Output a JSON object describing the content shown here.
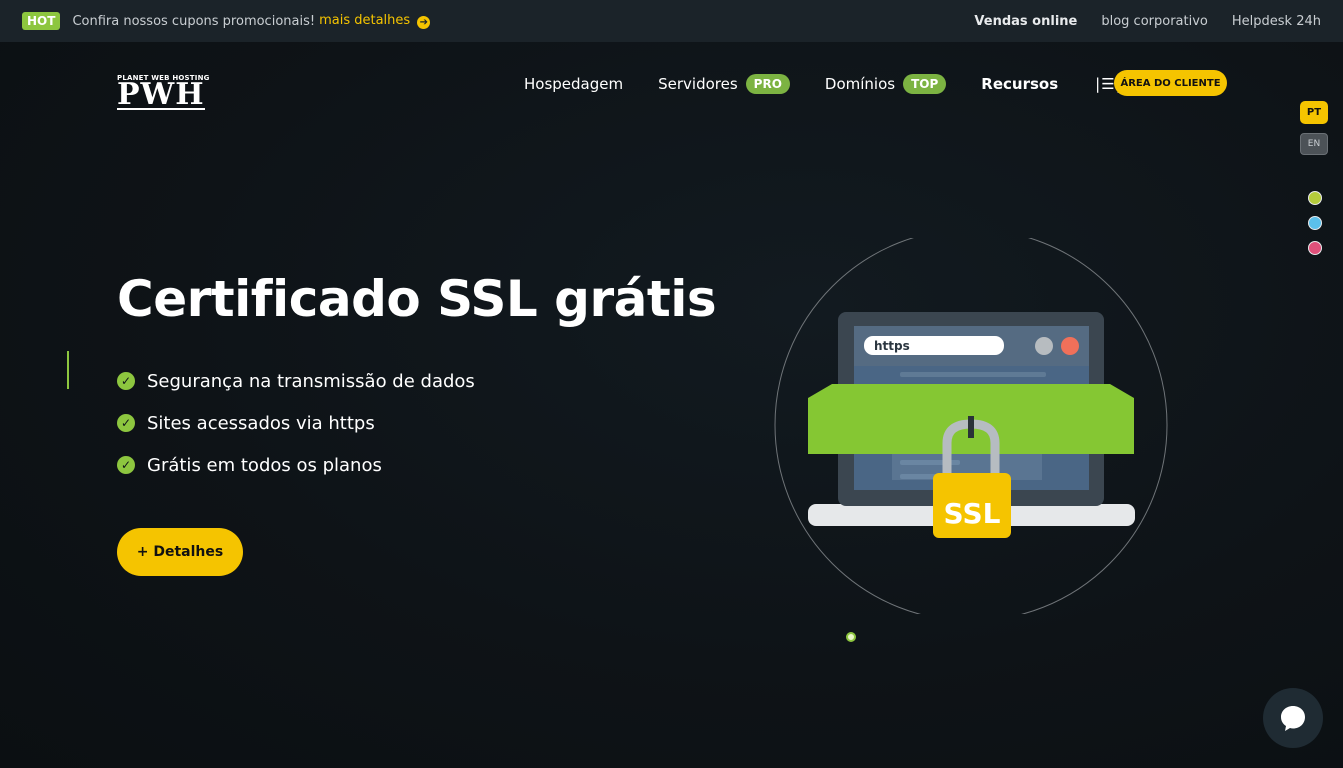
{
  "topbar": {
    "hot_badge": "HOT",
    "promo_text": "Confira nossos cupons promocionais!",
    "promo_link": "mais detalhes",
    "links": [
      "Vendas online",
      "blog corporativo",
      "Helpdesk 24h"
    ]
  },
  "logo": {
    "small_text": "PLANET WEB HOSTING",
    "big_text": "PWH"
  },
  "nav": {
    "items": [
      {
        "label": "Hospedagem"
      },
      {
        "label": "Servidores",
        "badge": "PRO"
      },
      {
        "label": "Domínios",
        "badge": "TOP"
      },
      {
        "label": "Recursos"
      }
    ],
    "client_button": "ÁREA DO CLIENTE"
  },
  "lang": {
    "pt": "PT",
    "en": "EN"
  },
  "theme_dots": {
    "colors": [
      "#b5cc3c",
      "#5bc0eb",
      "#e0507a"
    ]
  },
  "hero": {
    "title": "Certificado SSL grátis",
    "features": [
      "Segurança na transmissão de dados",
      "Sites acessados via https",
      "Grátis em todos os planos"
    ],
    "button": "+ Detalhes"
  },
  "illustration": {
    "url_text": "https",
    "lock_text": "SSL"
  },
  "colors": {
    "accent_green": "#8dc63f",
    "accent_yellow": "#f5c400",
    "background": "#0f1418",
    "topbar": "#1b2329"
  }
}
